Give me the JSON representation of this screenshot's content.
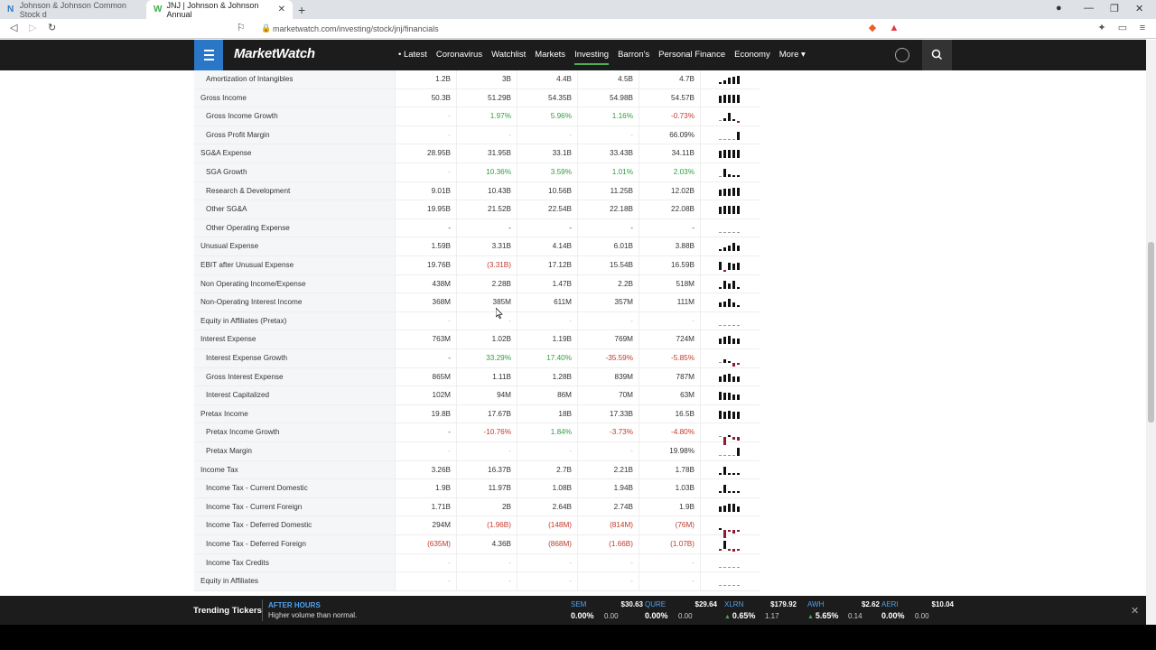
{
  "browser": {
    "tabs": [
      {
        "title": "Johnson & Johnson Common Stock d",
        "active": false
      },
      {
        "title": "JNJ | Johnson & Johnson Annual",
        "active": true
      }
    ],
    "url": "marketwatch.com/investing/stock/jnj/financials"
  },
  "header": {
    "logo": "MarketWatch",
    "nav": [
      "Latest",
      "Coronavirus",
      "Watchlist",
      "Markets",
      "Investing",
      "Barron's",
      "Personal Finance",
      "Economy",
      "More"
    ],
    "active_nav": "Investing"
  },
  "table": {
    "rows": [
      {
        "label": "Amortization of Intangibles",
        "sub": true,
        "values": [
          "1.2B",
          "3B",
          "4.4B",
          "4.5B",
          "4.7B"
        ],
        "tone": [
          "",
          "",
          "",
          "",
          ""
        ],
        "spark": [
          2,
          4,
          7,
          8,
          9
        ]
      },
      {
        "label": "Gross Income",
        "sub": false,
        "values": [
          "50.3B",
          "51.29B",
          "54.35B",
          "54.98B",
          "54.57B"
        ],
        "tone": [
          "",
          "",
          "",
          "",
          ""
        ],
        "spark": [
          8,
          9,
          9,
          9,
          9
        ]
      },
      {
        "label": "Gross Income Growth",
        "sub": true,
        "values": [
          "-",
          "1.97%",
          "5.96%",
          "1.16%",
          "-0.73%"
        ],
        "tone": [
          "muted",
          "pos",
          "pos",
          "pos",
          "neg"
        ],
        "spark": [
          0,
          3,
          9,
          2,
          -1
        ]
      },
      {
        "label": "Gross Profit Margin",
        "sub": true,
        "values": [
          "-",
          "-",
          "-",
          "-",
          "66.09%"
        ],
        "tone": [
          "muted",
          "muted",
          "muted",
          "muted",
          ""
        ],
        "spark": [
          0,
          0,
          0,
          0,
          9
        ]
      },
      {
        "label": "SG&A Expense",
        "sub": false,
        "values": [
          "28.95B",
          "31.95B",
          "33.1B",
          "33.43B",
          "34.11B"
        ],
        "tone": [
          "",
          "",
          "",
          "",
          ""
        ],
        "spark": [
          8,
          9,
          9,
          9,
          9
        ]
      },
      {
        "label": "SGA Growth",
        "sub": true,
        "values": [
          "-",
          "10.36%",
          "3.59%",
          "1.01%",
          "2.03%"
        ],
        "tone": [
          "muted",
          "pos",
          "pos",
          "pos",
          "pos"
        ],
        "spark": [
          0,
          9,
          3,
          1,
          2
        ]
      },
      {
        "label": "Research & Development",
        "sub": true,
        "values": [
          "9.01B",
          "10.43B",
          "10.56B",
          "11.25B",
          "12.02B"
        ],
        "tone": [
          "",
          "",
          "",
          "",
          ""
        ],
        "spark": [
          7,
          8,
          8,
          9,
          9
        ]
      },
      {
        "label": "Other SG&A",
        "sub": true,
        "values": [
          "19.95B",
          "21.52B",
          "22.54B",
          "22.18B",
          "22.08B"
        ],
        "tone": [
          "",
          "",
          "",
          "",
          ""
        ],
        "spark": [
          8,
          9,
          9,
          9,
          9
        ]
      },
      {
        "label": "Other Operating Expense",
        "sub": true,
        "values": [
          "-",
          "-",
          "-",
          "-",
          "-"
        ],
        "tone": [
          "",
          "",
          "",
          "",
          ""
        ],
        "spark": [
          0,
          0,
          0,
          0,
          0
        ]
      },
      {
        "label": "Unusual Expense",
        "sub": false,
        "values": [
          "1.59B",
          "3.31B",
          "4.14B",
          "6.01B",
          "3.88B"
        ],
        "tone": [
          "",
          "",
          "",
          "",
          ""
        ],
        "spark": [
          2,
          4,
          6,
          9,
          6
        ]
      },
      {
        "label": "EBIT after Unusual Expense",
        "sub": false,
        "values": [
          "19.76B",
          "(3.31B)",
          "17.12B",
          "15.54B",
          "16.59B"
        ],
        "tone": [
          "",
          "neg",
          "",
          "",
          ""
        ],
        "spark": [
          9,
          -1,
          8,
          7,
          8
        ]
      },
      {
        "label": "Non Operating Income/Expense",
        "sub": false,
        "values": [
          "438M",
          "2.28B",
          "1.47B",
          "2.2B",
          "518M"
        ],
        "tone": [
          "",
          "",
          "",
          "",
          ""
        ],
        "spark": [
          2,
          9,
          6,
          9,
          2
        ]
      },
      {
        "label": "Non-Operating Interest Income",
        "sub": false,
        "values": [
          "368M",
          "385M",
          "611M",
          "357M",
          "111M"
        ],
        "tone": [
          "",
          "",
          "",
          "",
          ""
        ],
        "spark": [
          5,
          6,
          9,
          5,
          1
        ]
      },
      {
        "label": "Equity in Affiliates (Pretax)",
        "sub": false,
        "values": [
          "-",
          "-",
          "-",
          "-",
          "-"
        ],
        "tone": [
          "muted",
          "muted",
          "muted",
          "muted",
          "muted"
        ],
        "spark": [
          0,
          0,
          0,
          0,
          0
        ]
      },
      {
        "label": "Interest Expense",
        "sub": false,
        "values": [
          "763M",
          "1.02B",
          "1.19B",
          "769M",
          "724M"
        ],
        "tone": [
          "",
          "",
          "",
          "",
          ""
        ],
        "spark": [
          6,
          8,
          9,
          6,
          6
        ]
      },
      {
        "label": "Interest Expense Growth",
        "sub": true,
        "values": [
          "-",
          "33.29%",
          "17.40%",
          "-35.59%",
          "-5.85%"
        ],
        "tone": [
          "",
          "pos",
          "pos",
          "neg",
          "neg"
        ],
        "spark": [
          0,
          4,
          2,
          -4,
          -1
        ]
      },
      {
        "label": "Gross Interest Expense",
        "sub": true,
        "values": [
          "865M",
          "1.11B",
          "1.28B",
          "839M",
          "787M"
        ],
        "tone": [
          "",
          "",
          "",
          "",
          ""
        ],
        "spark": [
          6,
          8,
          9,
          6,
          6
        ]
      },
      {
        "label": "Interest Capitalized",
        "sub": true,
        "values": [
          "102M",
          "94M",
          "86M",
          "70M",
          "63M"
        ],
        "tone": [
          "",
          "",
          "",
          "",
          ""
        ],
        "spark": [
          9,
          8,
          8,
          6,
          6
        ]
      },
      {
        "label": "Pretax Income",
        "sub": false,
        "values": [
          "19.8B",
          "17.67B",
          "18B",
          "17.33B",
          "16.5B"
        ],
        "tone": [
          "",
          "",
          "",
          "",
          ""
        ],
        "spark": [
          9,
          8,
          9,
          8,
          8
        ]
      },
      {
        "label": "Pretax Income Growth",
        "sub": true,
        "values": [
          "-",
          "-10.76%",
          "1.84%",
          "-3.73%",
          "-4.80%"
        ],
        "tone": [
          "",
          "neg",
          "pos",
          "neg",
          "neg"
        ],
        "spark": [
          0,
          -9,
          2,
          -3,
          -4
        ]
      },
      {
        "label": "Pretax Margin",
        "sub": true,
        "values": [
          "-",
          "-",
          "-",
          "-",
          "19.98%"
        ],
        "tone": [
          "muted",
          "muted",
          "muted",
          "muted",
          ""
        ],
        "spark": [
          0,
          0,
          0,
          0,
          9
        ]
      },
      {
        "label": "Income Tax",
        "sub": false,
        "values": [
          "3.26B",
          "16.37B",
          "2.7B",
          "2.21B",
          "1.78B"
        ],
        "tone": [
          "",
          "",
          "",
          "",
          ""
        ],
        "spark": [
          2,
          9,
          2,
          1,
          1
        ]
      },
      {
        "label": "Income Tax - Current Domestic",
        "sub": true,
        "values": [
          "1.9B",
          "11.97B",
          "1.08B",
          "1.94B",
          "1.03B"
        ],
        "tone": [
          "",
          "",
          "",
          "",
          ""
        ],
        "spark": [
          2,
          9,
          1,
          2,
          1
        ]
      },
      {
        "label": "Income Tax - Current Foreign",
        "sub": true,
        "values": [
          "1.71B",
          "2B",
          "2.64B",
          "2.74B",
          "1.9B"
        ],
        "tone": [
          "",
          "",
          "",
          "",
          ""
        ],
        "spark": [
          6,
          7,
          9,
          9,
          6
        ]
      },
      {
        "label": "Income Tax - Deferred Domestic",
        "sub": true,
        "values": [
          "294M",
          "(1.96B)",
          "(148M)",
          "(814M)",
          "(76M)"
        ],
        "tone": [
          "",
          "neg",
          "neg",
          "neg",
          "neg"
        ],
        "spark": [
          2,
          -9,
          -1,
          -4,
          -1
        ]
      },
      {
        "label": "Income Tax - Deferred Foreign",
        "sub": true,
        "values": [
          "(635M)",
          "4.36B",
          "(868M)",
          "(1.66B)",
          "(1.07B)"
        ],
        "tone": [
          "neg",
          "",
          "neg",
          "neg",
          "neg"
        ],
        "spark": [
          -1,
          9,
          -2,
          -3,
          -2
        ]
      },
      {
        "label": "Income Tax Credits",
        "sub": true,
        "values": [
          "-",
          "-",
          "-",
          "-",
          "-"
        ],
        "tone": [
          "muted",
          "muted",
          "muted",
          "muted",
          "muted"
        ],
        "spark": [
          0,
          0,
          0,
          0,
          0
        ]
      },
      {
        "label": "Equity in Affiliates",
        "sub": false,
        "values": [
          "-",
          "-",
          "-",
          "-",
          "-"
        ],
        "tone": [
          "muted",
          "muted",
          "muted",
          "muted",
          "muted"
        ],
        "spark": [
          0,
          0,
          0,
          0,
          0
        ]
      }
    ]
  },
  "ticker_bar": {
    "title": "Trending Tickers",
    "after_hours": "AFTER HOURS",
    "after_hours_sub": "Higher volume than normal.",
    "items": [
      {
        "symbol": "SEM",
        "price": "$30.63",
        "change_pct": "0.00%",
        "change": "0.00",
        "dir": "flat"
      },
      {
        "symbol": "QURE",
        "price": "$29.64",
        "change_pct": "0.00%",
        "change": "0.00",
        "dir": "flat"
      },
      {
        "symbol": "XLRN",
        "price": "$179.92",
        "change_pct": "0.65%",
        "change": "1.17",
        "dir": "up"
      },
      {
        "symbol": "AWH",
        "price": "$2.62",
        "change_pct": "5.65%",
        "change": "0.14",
        "dir": "up"
      },
      {
        "symbol": "AERI",
        "price": "$10.04",
        "change_pct": "0.00%",
        "change": "0.00",
        "dir": "flat"
      }
    ]
  }
}
